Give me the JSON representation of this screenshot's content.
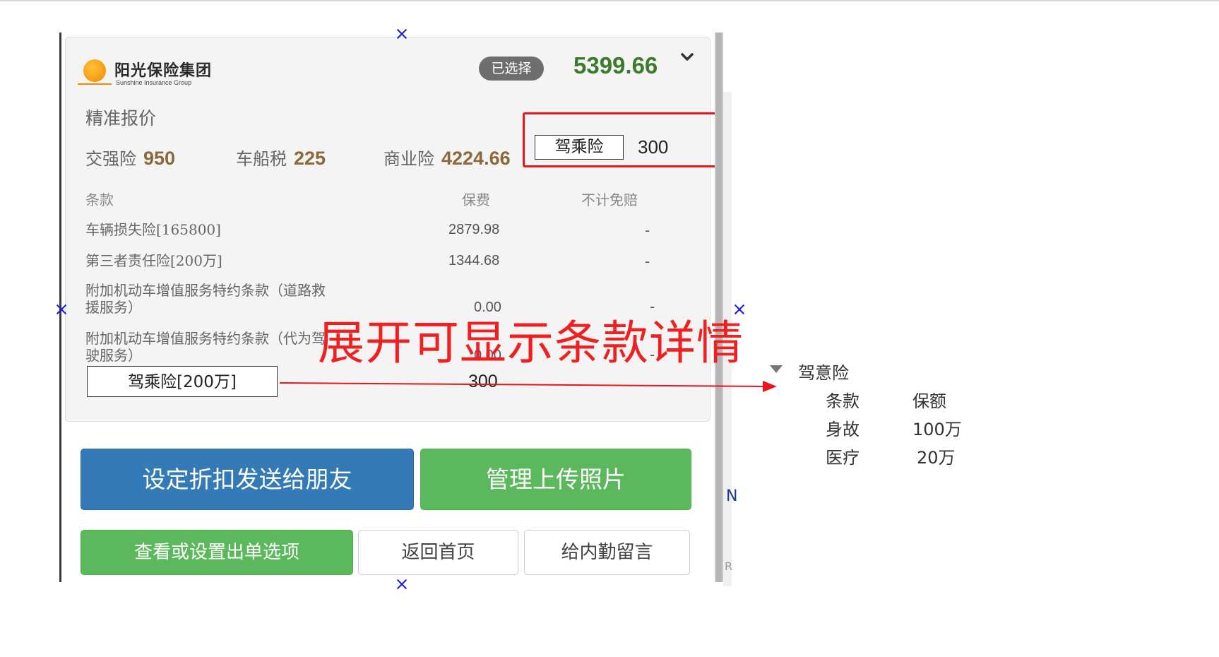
{
  "company": {
    "name_cn": "阳光保险集团",
    "name_en": "Sunshine Insurance Group"
  },
  "header": {
    "selected_badge": "已选择",
    "total_price": "5399.66",
    "expand_icon": "chevron-down-icon"
  },
  "quote": {
    "section_title": "精准报价",
    "fees": [
      {
        "label": "交强险",
        "value": "950"
      },
      {
        "label": "车船税",
        "value": "225"
      },
      {
        "label": "商业险",
        "value": "4224.66"
      }
    ],
    "rider_label": "驾乘险",
    "rider_value": "300"
  },
  "table": {
    "headers": {
      "clause": "条款",
      "premium": "保费",
      "deductible": "不计免赔"
    },
    "rows": [
      {
        "name": "车辆损失险[165800]",
        "premium": "2879.98",
        "deductible": "-"
      },
      {
        "name": "第三者责任险[200万]",
        "premium": "1344.68",
        "deductible": "-"
      },
      {
        "name_line1": "附加机动车增值服务特约条款（道路救",
        "name_line2": "援服务）",
        "premium": "0.00",
        "deductible": "-"
      },
      {
        "name_line1": "附加机动车增值服务特约条款（代为驾",
        "name_line2": "驶服务）",
        "premium": "0.00",
        "deductible": "-"
      }
    ],
    "rider_row": {
      "name": "驾乘险[200万]",
      "premium": "300"
    }
  },
  "annotation": {
    "text": "展开可显示条款详情",
    "color": "#f02020"
  },
  "detail_tree": {
    "title": "驾意险",
    "col_clause": "条款",
    "col_amount": "保额",
    "items": [
      {
        "clause": "身故",
        "amount": "100万"
      },
      {
        "clause": "医疗",
        "amount": "20万"
      }
    ]
  },
  "buttons": {
    "discount_send": "设定折扣发送给朋友",
    "upload_photos": "管理上传照片",
    "order_options": "查看或设置出单选项",
    "back_home": "返回首页",
    "message_staff": "给内勤留言"
  },
  "colors": {
    "primary_blue": "#337ab7",
    "success_green": "#5cb85c",
    "price_green": "#3d7a2e",
    "amount_brown": "#8a6a3a",
    "highlight_red": "#e8141b"
  }
}
